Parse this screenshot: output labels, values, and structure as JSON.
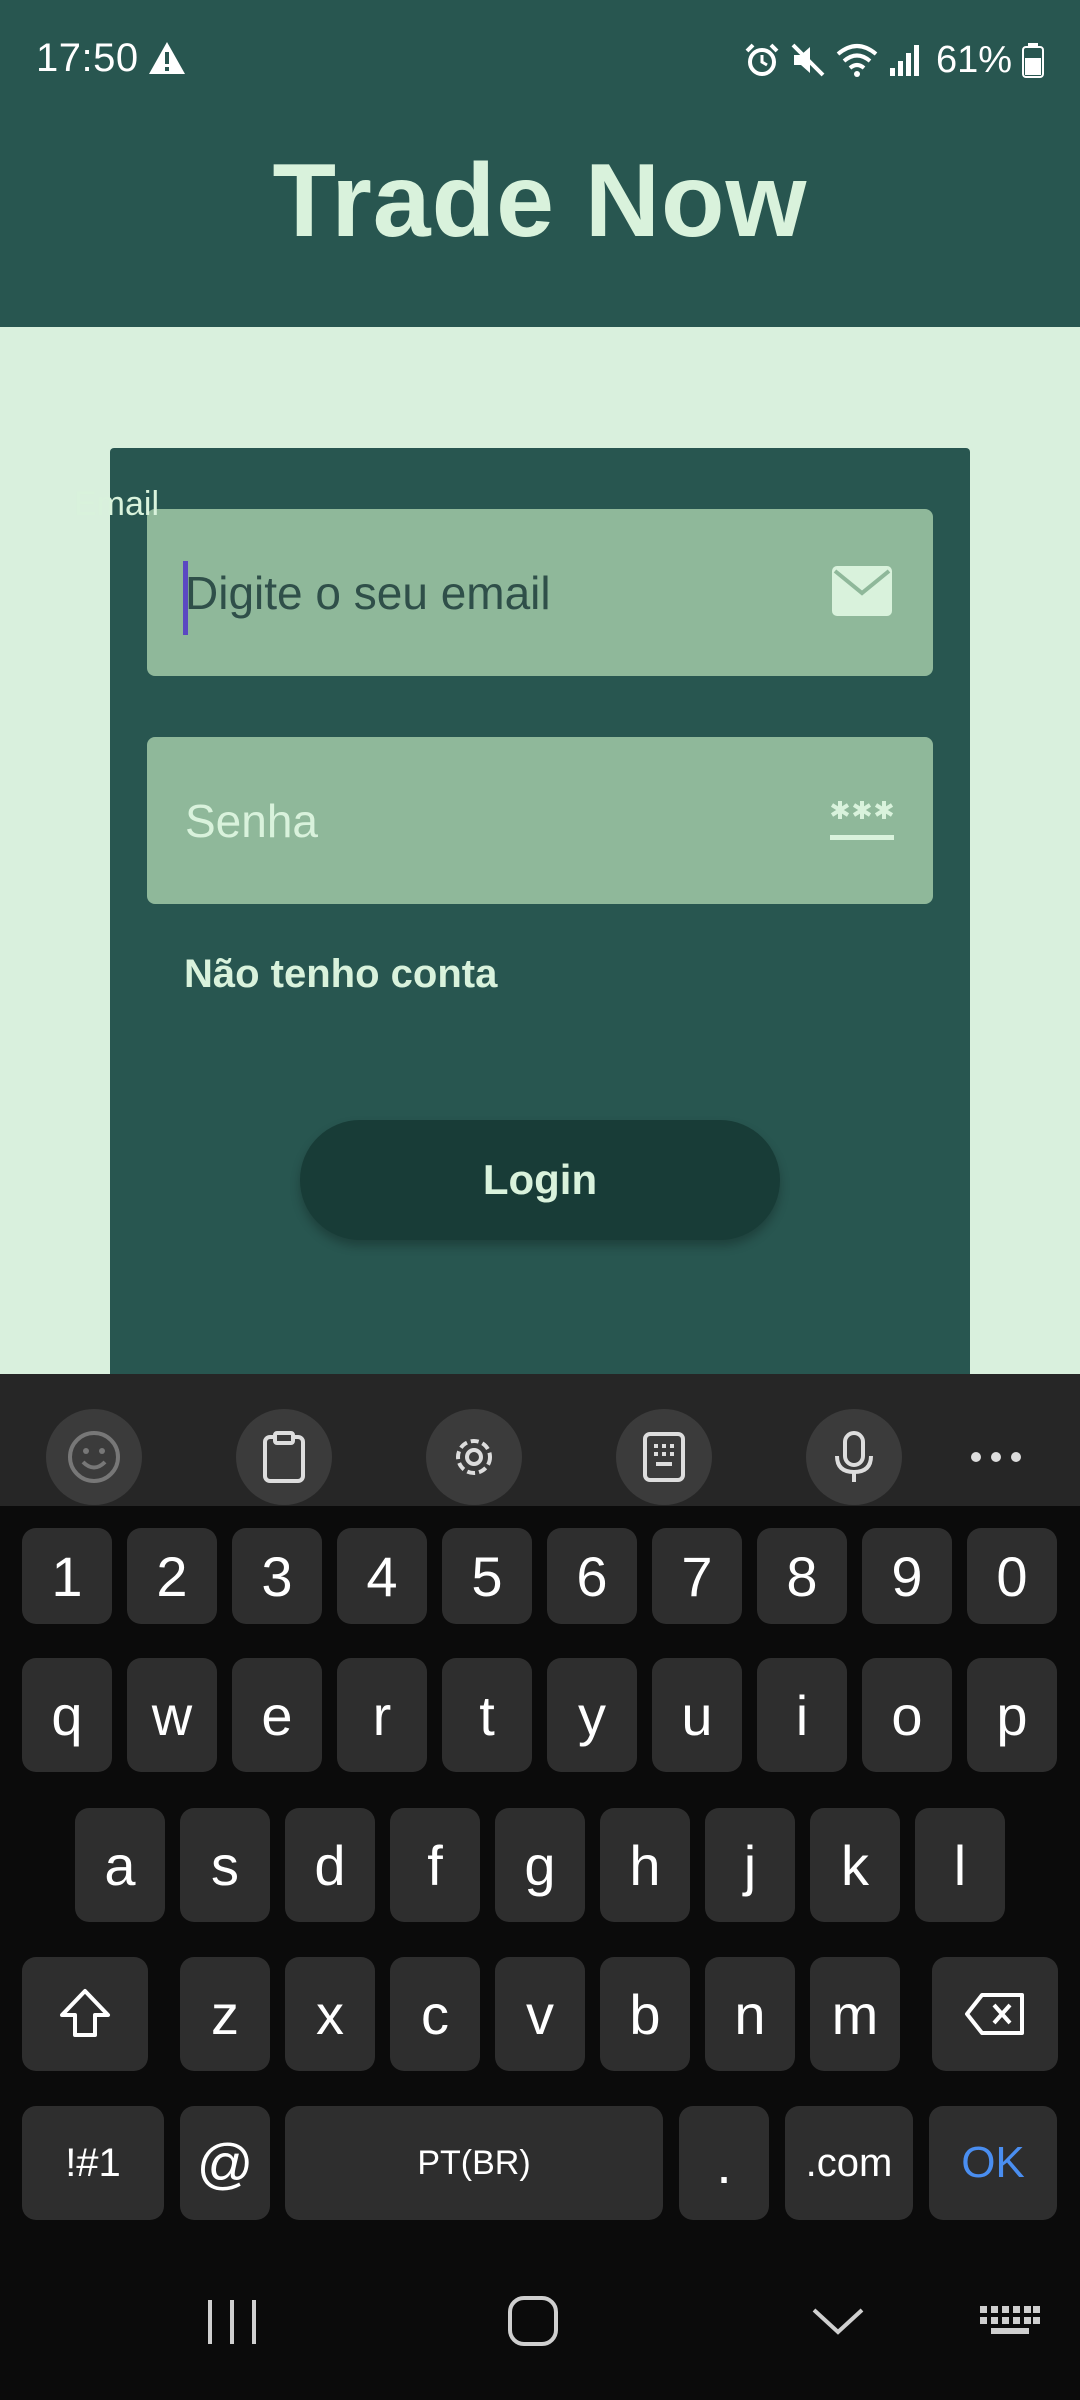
{
  "status_bar": {
    "time": "17:50",
    "battery": "61%",
    "icons": [
      "warning-icon",
      "alarm-icon",
      "mute-icon",
      "wifi-icon",
      "signal-icon",
      "battery-icon"
    ]
  },
  "app": {
    "title": "Trade Now"
  },
  "login_form": {
    "email_label": "Email",
    "email_placeholder": "Digite o seu email",
    "email_icon": "mail-icon",
    "password_placeholder": "Senha",
    "password_icon": "password-dots-icon",
    "no_account_link": "Não tenho conta",
    "login_button": "Login"
  },
  "keyboard": {
    "toolbar": [
      "emoji-icon",
      "clipboard-icon",
      "settings-icon",
      "keyboard-mode-icon",
      "microphone-icon",
      "more-icon"
    ],
    "row1": [
      "1",
      "2",
      "3",
      "4",
      "5",
      "6",
      "7",
      "8",
      "9",
      "0"
    ],
    "row2": [
      "q",
      "w",
      "e",
      "r",
      "t",
      "y",
      "u",
      "i",
      "o",
      "p"
    ],
    "row3": [
      "a",
      "s",
      "d",
      "f",
      "g",
      "h",
      "j",
      "k",
      "l"
    ],
    "row4": [
      "z",
      "x",
      "c",
      "v",
      "b",
      "n",
      "m"
    ],
    "bottom": {
      "symbols": "!#1",
      "at": "@",
      "space": "PT(BR)",
      "period": ".",
      "dotcom": ".com",
      "ok": "OK"
    }
  },
  "nav_bar": [
    "recent-apps-icon",
    "home-icon",
    "back-icon",
    "keyboard-hide-icon"
  ],
  "colors": {
    "header_bg": "#285650",
    "page_bg": "#d9f0dd",
    "field_bg": "#8fb89a",
    "button_bg": "#183c37",
    "accent_text": "#d9f2dc",
    "keyboard_bg": "#0b0b0b",
    "key_bg": "#2e2e2e",
    "ok_color": "#4a8ef0"
  }
}
